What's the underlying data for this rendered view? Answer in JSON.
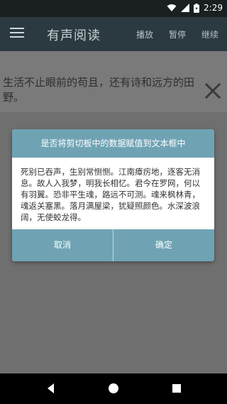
{
  "status_bar": {
    "time": "2:29"
  },
  "app_bar": {
    "title": "有声阅读",
    "actions": [
      "播放",
      "暂停",
      "继续"
    ]
  },
  "main": {
    "text": "生活不止眼前的苟且，还有诗和远方的田野。"
  },
  "dialog": {
    "title": "是否将剪切板中的数据赋值到文本框中",
    "message": "死别已吞声，生别常恻恻。江南瘴疠地，逐客无消息。故人入我梦，明我长相忆。君今在罗网，何以有羽翼。恐非平生魂，路远不可测。魂来枫林青，魂返关塞黑。落月满屋梁，犹疑照颜色。水深波浪阔，无使蛟龙得。",
    "cancel_label": "取消",
    "confirm_label": "确定"
  },
  "icons": {
    "menu": "menu-icon",
    "close": "close-icon",
    "wifi": "wifi-icon",
    "signal": "signal-icon",
    "battery": "battery-icon",
    "back": "back-icon",
    "home": "home-icon",
    "recents": "recents-icon"
  },
  "colors": {
    "app_bar": "#2b3a40",
    "dialog_accent": "#6fa3b4",
    "status_bar": "#1a1f22"
  }
}
